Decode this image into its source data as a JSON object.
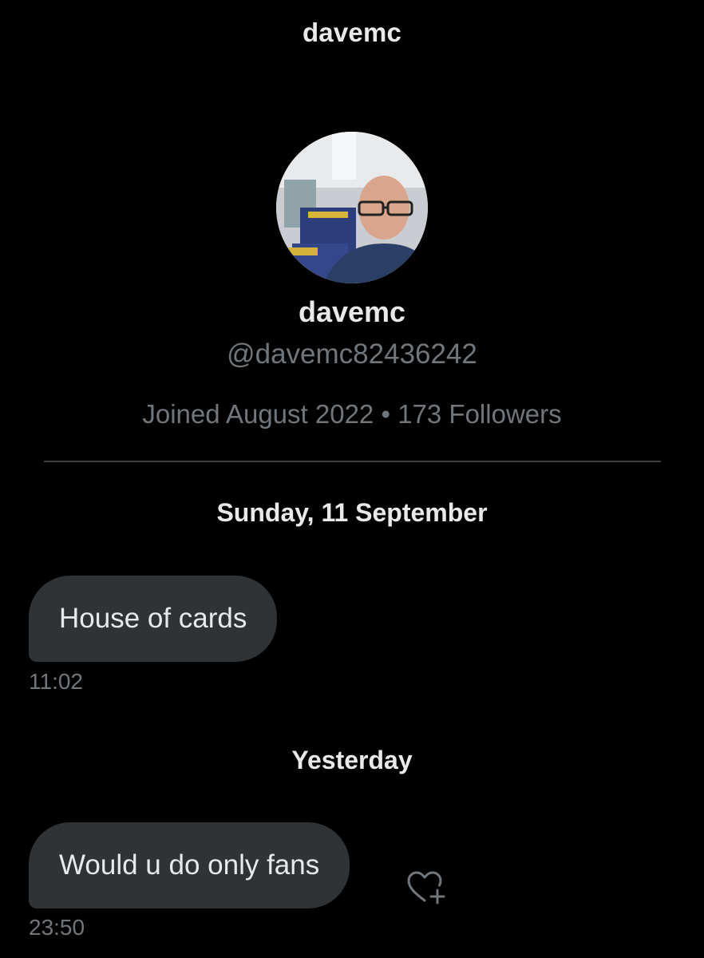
{
  "header": {
    "title": "davemc"
  },
  "profile": {
    "name": "davemc",
    "handle": "@davemc82436242",
    "joined": "Joined August 2022",
    "separator": "•",
    "followers": "173 Followers"
  },
  "conversation": {
    "groups": [
      {
        "date": "Sunday, 11 September",
        "messages": [
          {
            "text": "House of cards",
            "time": "11:02"
          }
        ]
      },
      {
        "date": "Yesterday",
        "messages": [
          {
            "text": "Would u do only fans",
            "time": "23:50"
          }
        ]
      }
    ]
  },
  "icons": {
    "avatar": "profile-photo",
    "reaction": "heart-plus-icon"
  },
  "colors": {
    "background": "#000000",
    "primary_text": "#e7e9ea",
    "secondary_text": "#71767b",
    "bubble": "#2f3336",
    "divider": "#3e4144"
  }
}
